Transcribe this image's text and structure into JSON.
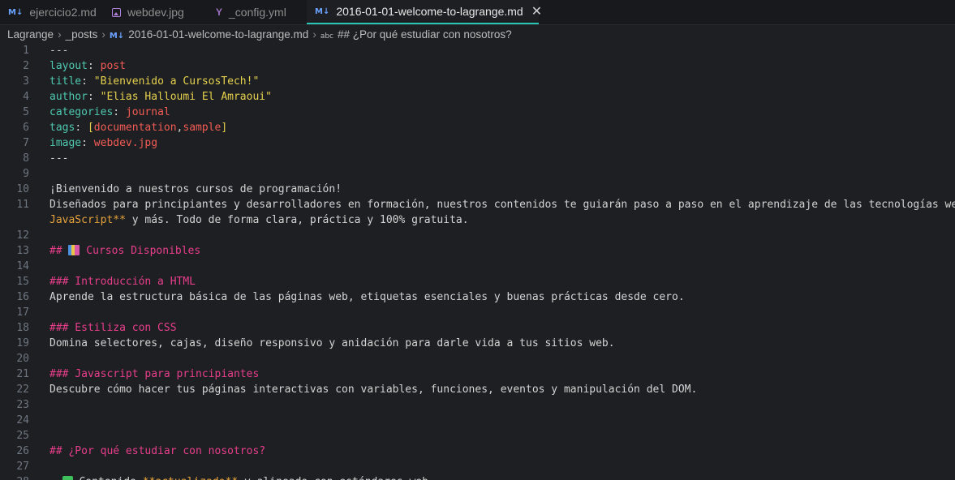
{
  "tabs": [
    {
      "label": "ejercicio2.md",
      "icon": "markdown-icon",
      "icon_text": "M↓",
      "active": false
    },
    {
      "label": "webdev.jpg",
      "icon": "image-icon",
      "active": false
    },
    {
      "label": "_config.yml",
      "icon": "yaml-icon",
      "icon_text": "Y",
      "active": false
    },
    {
      "label": "2016-01-01-welcome-to-lagrange.md",
      "icon": "markdown-icon",
      "icon_text": "M↓",
      "active": true
    }
  ],
  "close_glyph": "✕",
  "breadcrumb": {
    "items": [
      "Lagrange",
      "_posts",
      "2016-01-01-welcome-to-lagrange.md",
      "## ¿Por qué estudiar con nosotros?"
    ],
    "md_icon_text": "M↓",
    "symbol_icon_text": "abc",
    "separator": "›"
  },
  "editor": {
    "lines": [
      {
        "n": "1",
        "t": [
          {
            "c": "c-dash",
            "s": "---"
          }
        ]
      },
      {
        "n": "2",
        "t": [
          {
            "c": "c-key",
            "s": "layout"
          },
          {
            "c": "c-txt",
            "s": ": "
          },
          {
            "c": "c-val",
            "s": "post"
          }
        ]
      },
      {
        "n": "3",
        "t": [
          {
            "c": "c-key",
            "s": "title"
          },
          {
            "c": "c-txt",
            "s": ": "
          },
          {
            "c": "c-str",
            "s": "\"Bienvenido a CursosTech!\""
          }
        ]
      },
      {
        "n": "4",
        "t": [
          {
            "c": "c-key",
            "s": "author"
          },
          {
            "c": "c-txt",
            "s": ": "
          },
          {
            "c": "c-str",
            "s": "\"Elias Halloumi El Amraoui\""
          }
        ]
      },
      {
        "n": "5",
        "t": [
          {
            "c": "c-key",
            "s": "categories"
          },
          {
            "c": "c-txt",
            "s": ": "
          },
          {
            "c": "c-val",
            "s": "journal"
          }
        ]
      },
      {
        "n": "6",
        "t": [
          {
            "c": "c-key",
            "s": "tags"
          },
          {
            "c": "c-txt",
            "s": ": "
          },
          {
            "c": "c-str",
            "s": "["
          },
          {
            "c": "c-val",
            "s": "documentation"
          },
          {
            "c": "c-txt",
            "s": ","
          },
          {
            "c": "c-val",
            "s": "sample"
          },
          {
            "c": "c-str",
            "s": "]"
          }
        ]
      },
      {
        "n": "7",
        "t": [
          {
            "c": "c-key",
            "s": "image"
          },
          {
            "c": "c-txt",
            "s": ": "
          },
          {
            "c": "c-val",
            "s": "webdev.jpg"
          }
        ]
      },
      {
        "n": "8",
        "t": [
          {
            "c": "c-dash",
            "s": "---"
          }
        ]
      },
      {
        "n": "9",
        "t": []
      },
      {
        "n": "10",
        "t": [
          {
            "c": "c-txt",
            "s": "¡Bienvenido a nuestros cursos de programación!"
          }
        ]
      },
      {
        "n": "11",
        "t": [
          {
            "c": "c-txt",
            "s": "Diseñados para principiantes y desarrolladores en formación, nuestros contenidos te guiarán paso a paso en el aprendizaje de las tecnologías web"
          }
        ]
      },
      {
        "n": "",
        "t": [
          {
            "c": "c-bold",
            "s": "JavaScript**"
          },
          {
            "c": "c-txt",
            "s": " y más. Todo de forma clara, práctica y 100% gratuita."
          }
        ]
      },
      {
        "n": "12",
        "t": []
      },
      {
        "n": "13",
        "t": [
          {
            "c": "c-head",
            "s": "## "
          },
          {
            "emoji": "books"
          },
          {
            "c": "c-head",
            "s": " Cursos Disponibles"
          }
        ]
      },
      {
        "n": "14",
        "t": []
      },
      {
        "n": "15",
        "t": [
          {
            "c": "c-head",
            "s": "### Introducción a HTML"
          }
        ]
      },
      {
        "n": "16",
        "t": [
          {
            "c": "c-txt",
            "s": "Aprende la estructura básica de las páginas web, etiquetas esenciales y buenas prácticas desde cero."
          }
        ]
      },
      {
        "n": "17",
        "t": []
      },
      {
        "n": "18",
        "t": [
          {
            "c": "c-head",
            "s": "### Estiliza con CSS"
          }
        ]
      },
      {
        "n": "19",
        "t": [
          {
            "c": "c-txt",
            "s": "Domina selectores, cajas, diseño responsivo y anidación para darle vida a tus sitios web."
          }
        ]
      },
      {
        "n": "20",
        "t": []
      },
      {
        "n": "21",
        "t": [
          {
            "c": "c-head",
            "s": "### Javascript para principiantes"
          }
        ]
      },
      {
        "n": "22",
        "t": [
          {
            "c": "c-txt",
            "s": "Descubre cómo hacer tus páginas interactivas con variables, funciones, eventos y manipulación del DOM."
          }
        ]
      },
      {
        "n": "23",
        "t": []
      },
      {
        "n": "24",
        "t": []
      },
      {
        "n": "25",
        "t": []
      },
      {
        "n": "26",
        "t": [
          {
            "c": "c-head",
            "s": "## ¿Por qué estudiar con nosotros?"
          }
        ]
      },
      {
        "n": "27",
        "t": []
      },
      {
        "n": "28",
        "t": [
          {
            "c": "c-txt",
            "s": "  "
          },
          {
            "emoji": "check"
          },
          {
            "c": "c-txt",
            "s": " Contenido "
          },
          {
            "c": "c-bold",
            "s": "**actualizado**"
          },
          {
            "c": "c-txt",
            "s": " y alineado con estándares web"
          }
        ]
      }
    ]
  },
  "colors": {
    "background": "#1e1f22",
    "tab_active_border": "#29c5b6",
    "yaml_key": "#4ec9b0",
    "yaml_value": "#f25c54",
    "string": "#e5d04e",
    "heading": "#e83e8c",
    "bold": "#e5a23c"
  }
}
